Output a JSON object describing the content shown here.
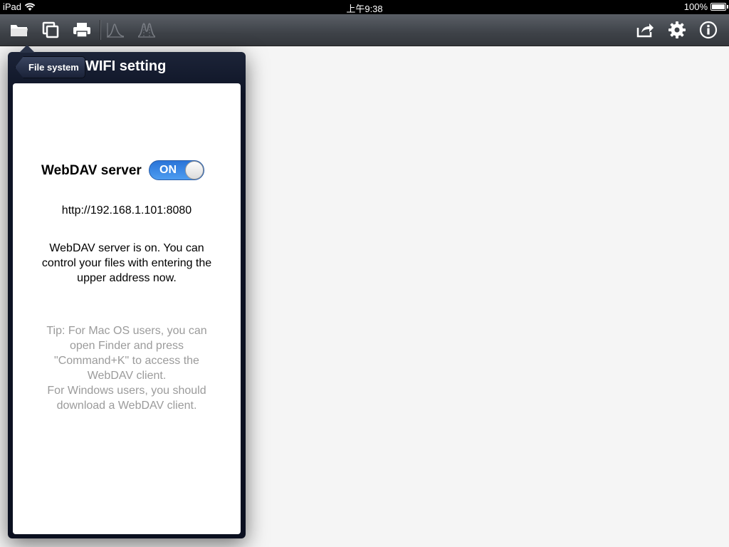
{
  "status_bar": {
    "device": "iPad",
    "time": "上午9:38",
    "battery": "100%"
  },
  "toolbar": {
    "left_icons": [
      "folder-icon",
      "copy-icon",
      "print-icon",
      "spectrum-icon",
      "peaks-icon"
    ],
    "right_icons": [
      "share-icon",
      "gear-icon",
      "info-icon"
    ]
  },
  "popover": {
    "back_label": "File system",
    "title": "WIFI setting",
    "webdav_label": "WebDAV server",
    "toggle_label": "ON",
    "toggle_on": true,
    "address": "http://192.168.1.101:8080",
    "status_message": "WebDAV server is on. You can control your files with entering the upper address now.",
    "tip_mac": "Tip: For Mac OS users, you can open Finder and press \"Command+K\" to access the WebDAV client.",
    "tip_windows": "For Windows users, you should download a WebDAV client."
  },
  "colors": {
    "toggle_on": "#2a74d8",
    "popover_bg": "#0e1426",
    "tip_text": "#9b9b9b"
  }
}
